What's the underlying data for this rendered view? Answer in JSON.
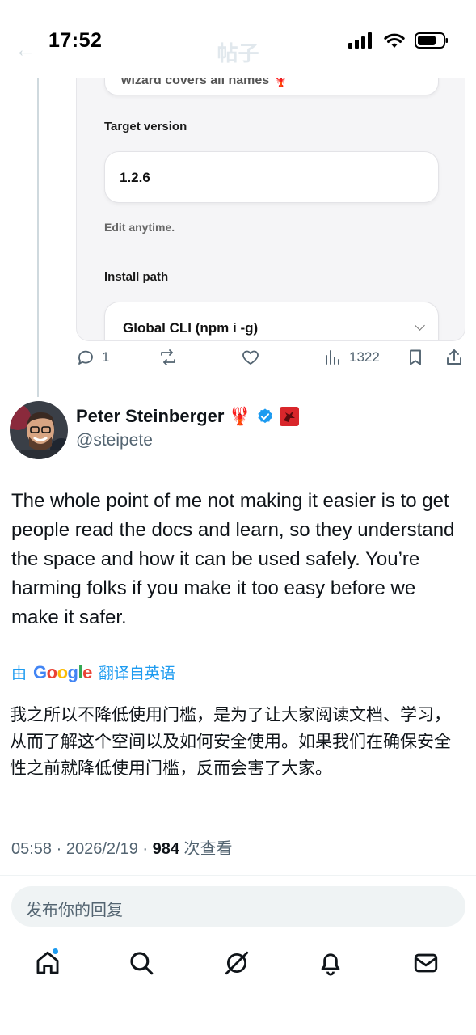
{
  "status_bar": {
    "time": "17:52",
    "ghost_title": "帖子"
  },
  "card": {
    "top_field_text": "wizard covers all names 🦞",
    "target_version_label": "Target version",
    "target_version_value": "1.2.6",
    "hint": "Edit anytime.",
    "install_path_label": "Install path",
    "install_path_value": "Global CLI (npm i -g)"
  },
  "actions": {
    "replies": "1",
    "views": "1322"
  },
  "author": {
    "name": "Peter Steinberger",
    "emoji": "🦞",
    "handle": "@steipete"
  },
  "post": {
    "text": "The whole point of me not making it easier is to get people read the docs and learn, so they understand the space and how it can be used safely. You’re harming folks if you make it too easy before we make it safer.",
    "translate_prefix": "由",
    "translate_provider": "Google",
    "translate_label": "翻译自英语",
    "translated_text": "我之所以不降低使用门槛，是为了让大家阅读文档、学习，从而了解这个空间以及如何安全使用。如果我们在确保安全性之前就降低使用门槛，反而会害了大家。",
    "time": "05:58",
    "date": "2026/2/19",
    "view_count": "984",
    "view_label": "次查看"
  },
  "reply": {
    "placeholder": "发布你的回复"
  },
  "colors": {
    "accent": "#1d9bf0",
    "muted": "#536471",
    "text": "#0f1419"
  }
}
